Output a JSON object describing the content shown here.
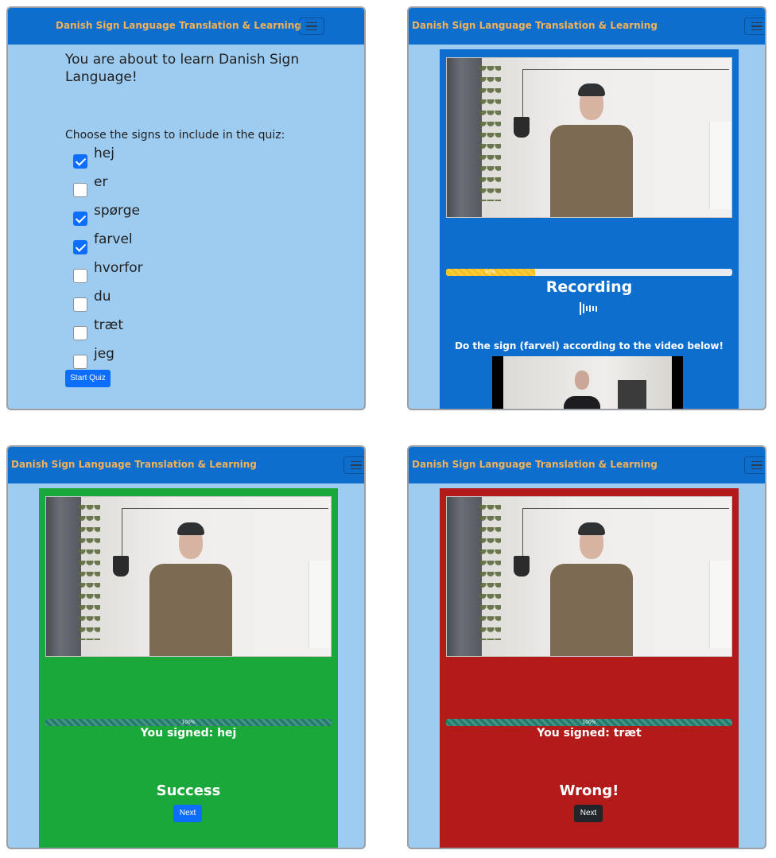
{
  "app": {
    "brand": "Danish Sign Language Translation & Learning"
  },
  "colors": {
    "nav": "#0d6ecd",
    "brand_text": "#f2b25a",
    "page_bg": "#9ecbf0",
    "card_recording": "#0d6ecd",
    "card_success": "#1ba83a",
    "card_wrong": "#b31b1b",
    "progress_recording": "#f5c01c",
    "progress_done": "#1f7a6a"
  },
  "setup": {
    "heading": "You are about to learn Danish Sign Language!",
    "prompt": "Choose the signs to include in the quiz:",
    "signs": [
      {
        "label": "hej",
        "checked": true
      },
      {
        "label": "er",
        "checked": false
      },
      {
        "label": "spørge",
        "checked": true
      },
      {
        "label": "farvel",
        "checked": true
      },
      {
        "label": "hvorfor",
        "checked": false
      },
      {
        "label": "du",
        "checked": false
      },
      {
        "label": "træt",
        "checked": false
      },
      {
        "label": "jeg",
        "checked": false
      }
    ],
    "start_button": "Start Quiz"
  },
  "recording": {
    "progress": 31,
    "progress_label": "45%",
    "status": "Recording",
    "instruction": "Do the sign (farvel) according to the video below!"
  },
  "success": {
    "progress": 100,
    "progress_label": "100%",
    "signed_text": "You signed: hej",
    "result": "Success",
    "next_button": "Next"
  },
  "wrong": {
    "progress": 100,
    "progress_label": "100%",
    "signed_text": "You signed: træt",
    "result": "Wrong!",
    "next_button": "Next"
  }
}
